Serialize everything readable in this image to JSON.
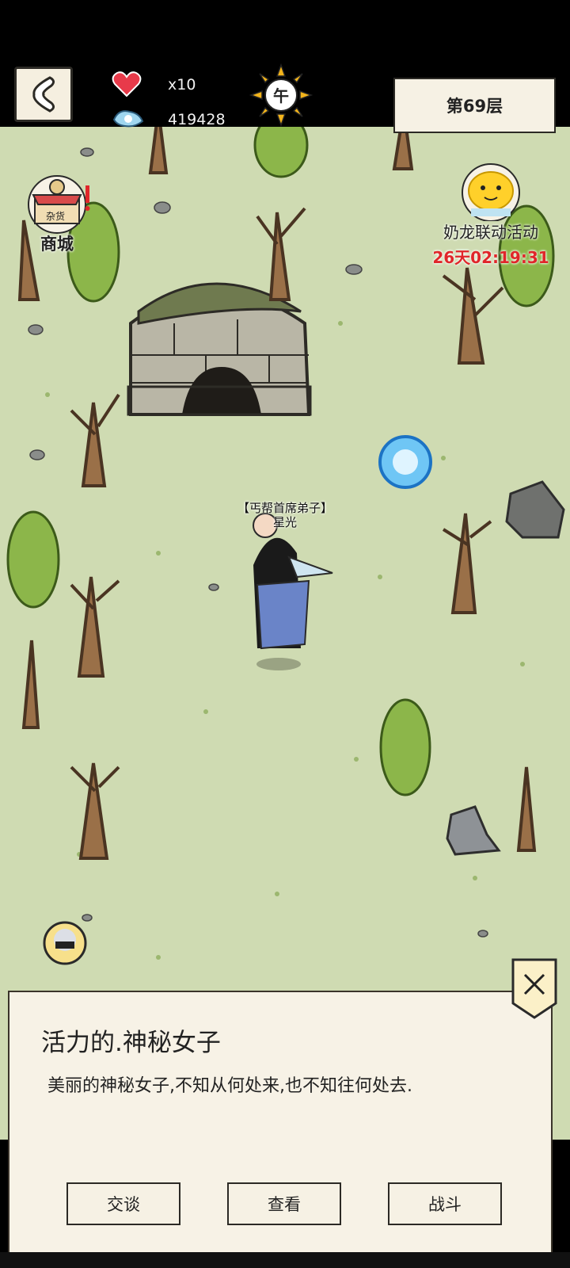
{
  "hud": {
    "lives": "x10",
    "spirit": "419428",
    "time_of_day": "午",
    "floor": "第69层"
  },
  "shop": {
    "label": "商城",
    "sign": "杂货"
  },
  "event": {
    "label": "奶龙联动活动",
    "timer": "26天02:19:31"
  },
  "npc": {
    "title": "【丐帮首席弟子】",
    "name": "星光"
  },
  "dialog": {
    "title": "活力的.神秘女子",
    "description": "美丽的神秘女子,不知从何处来,也不知往何处去.",
    "actions": [
      "交谈",
      "查看",
      "战斗"
    ]
  },
  "colors": {
    "grass": "#cfdbb2",
    "panel": "#f7f2e6",
    "timer": "#e0262a"
  }
}
